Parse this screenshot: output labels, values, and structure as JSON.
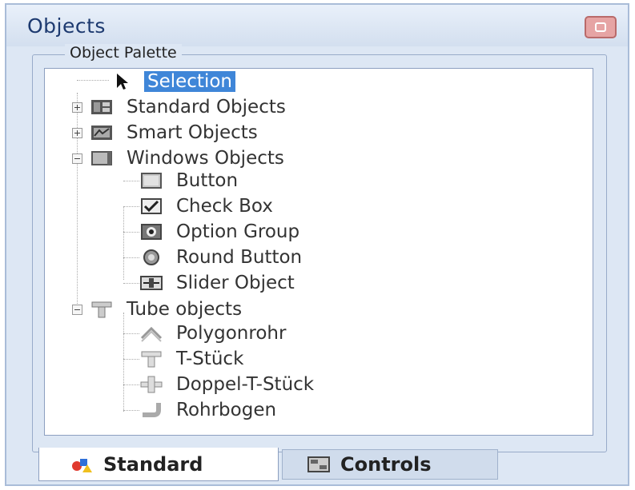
{
  "window": {
    "title": "Objects"
  },
  "palette": {
    "label": "Object Palette"
  },
  "tree": {
    "selection": "Selection",
    "standard_objects": "Standard Objects",
    "smart_objects": "Smart Objects",
    "windows_objects": {
      "label": "Windows Objects",
      "children": [
        "Button",
        "Check Box",
        "Option Group",
        "Round Button",
        "Slider Object"
      ]
    },
    "tube_objects": {
      "label": "Tube objects",
      "children": [
        "Polygonrohr",
        "T-Stück",
        "Doppel-T-Stück",
        "Rohrbogen"
      ]
    }
  },
  "tabs": [
    {
      "label": "Standard",
      "active": true
    },
    {
      "label": "Controls",
      "active": false
    }
  ],
  "colors": {
    "selection": "#3f86d8",
    "panel": "#dde7f4"
  }
}
